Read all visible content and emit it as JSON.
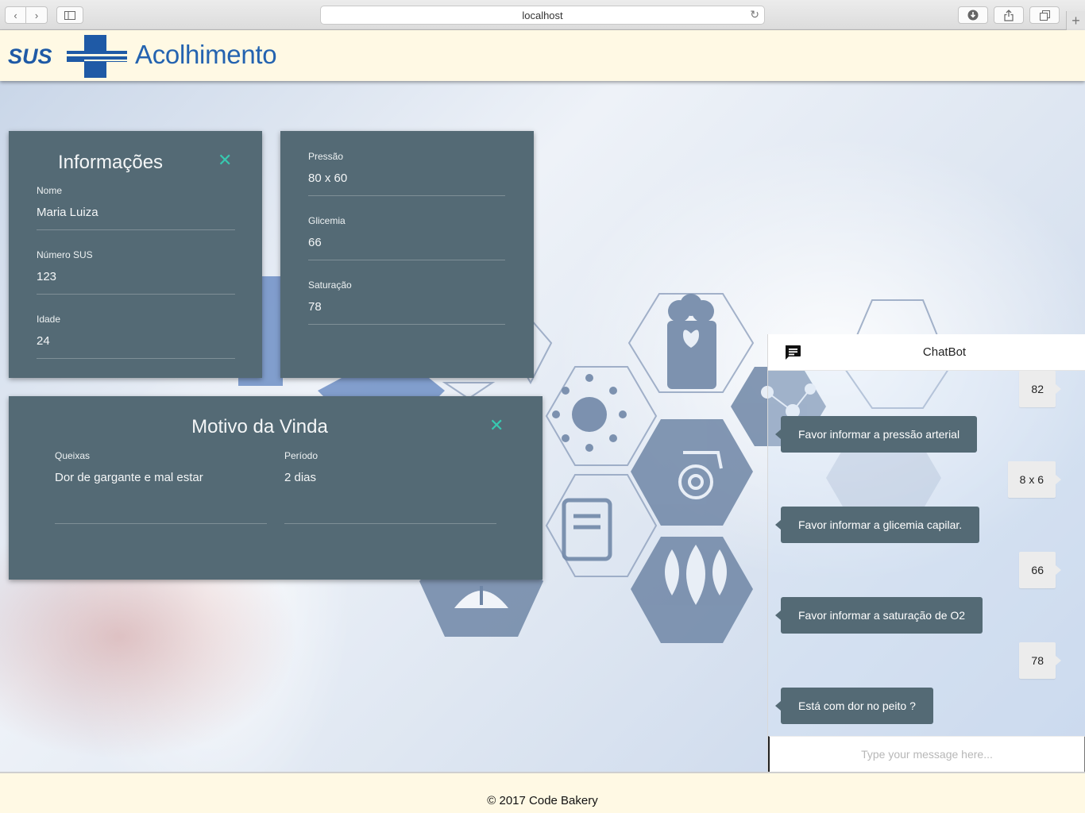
{
  "browser": {
    "url": "localhost",
    "icons": [
      "back-icon",
      "forward-icon",
      "sidebar-icon",
      "reload-icon",
      "download-icon",
      "share-icon",
      "tabs-icon",
      "new-tab-icon"
    ]
  },
  "header": {
    "logo_text": "SUS",
    "title": "Acolhimento",
    "brand_color": "#2463b0",
    "background": "#fff9e4"
  },
  "info_card": {
    "title": "Informações",
    "close_icon": "close-icon",
    "fields": [
      {
        "label": "Nome",
        "value": "Maria Luiza"
      },
      {
        "label": "Número SUS",
        "value": "123"
      },
      {
        "label": "Idade",
        "value": "24"
      }
    ]
  },
  "vitals_card": {
    "fields": [
      {
        "label": "Pressão",
        "value": "80 x 60"
      },
      {
        "label": "Glicemia",
        "value": "66"
      },
      {
        "label": "Saturação",
        "value": "78"
      }
    ]
  },
  "reason_card": {
    "title": "Motivo da Vinda",
    "close_icon": "close-icon",
    "fields": [
      {
        "label": "Queixas",
        "value": "Dor de gargante e mal estar"
      },
      {
        "label": "Período",
        "value": "2 dias"
      }
    ]
  },
  "chat": {
    "title": "ChatBot",
    "icon": "chat-icon",
    "messages": [
      {
        "from": "user",
        "text": "82"
      },
      {
        "from": "bot",
        "text": "Favor informar a pressão arterial"
      },
      {
        "from": "user",
        "text": "8 x 6"
      },
      {
        "from": "bot",
        "text": "Favor informar a glicemia capilar."
      },
      {
        "from": "user",
        "text": "66"
      },
      {
        "from": "bot",
        "text": "Favor informar a saturação de O2"
      },
      {
        "from": "user",
        "text": "78"
      },
      {
        "from": "bot",
        "text": "Está com dor no peito ?"
      }
    ],
    "input_placeholder": "Type your message here..."
  },
  "footer": {
    "text": "© 2017 Code Bakery"
  },
  "colors": {
    "card": "#546a75",
    "accent": "#37c9b0",
    "chat_bubble_user": "#ececec"
  }
}
